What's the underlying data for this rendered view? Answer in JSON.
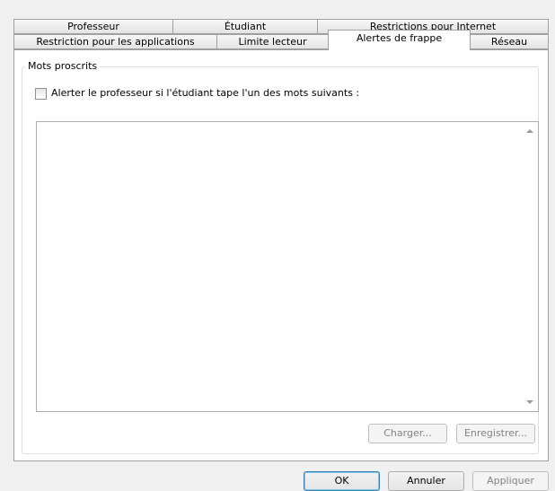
{
  "tabs_back_row": [
    {
      "label": "Professeur"
    },
    {
      "label": "Étudiant"
    },
    {
      "label": "Restrictions pour Internet"
    }
  ],
  "tabs_front_row": [
    {
      "label": "Restriction pour les applications"
    },
    {
      "label": "Limite lecteur"
    },
    {
      "label": "Alertes de frappe",
      "active": true
    },
    {
      "label": "Réseau"
    }
  ],
  "group": {
    "title": "Mots proscrits",
    "checkbox_label": "Alerter le professeur si l'étudiant tape l'un des mots suivants :",
    "checkbox_checked": false,
    "words_text": ""
  },
  "panel_buttons": {
    "load": "Charger...",
    "save": "Enregistrer..."
  },
  "dialog_buttons": {
    "ok": "OK",
    "cancel": "Annuler",
    "apply": "Appliquer"
  }
}
